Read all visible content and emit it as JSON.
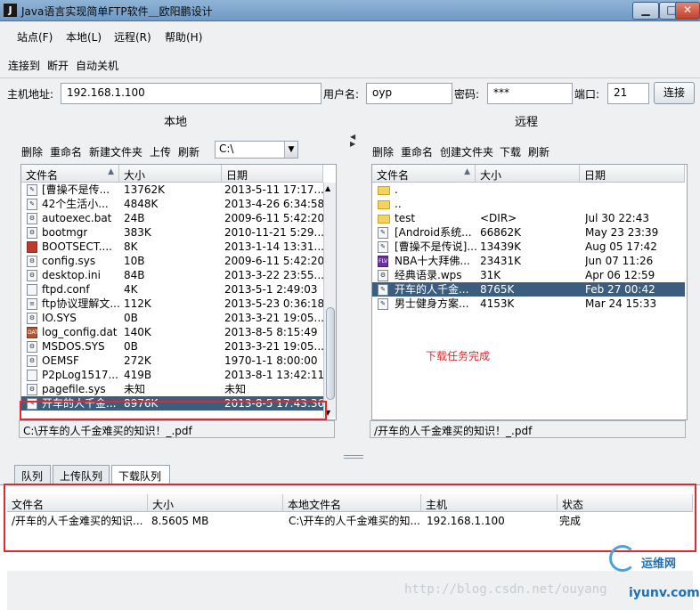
{
  "window": {
    "title": "Java语言实现简单FTP软件＿欧阳鹏设计",
    "app_icon": "java-app-icon",
    "controls": [
      "minimize",
      "maximize",
      "close"
    ]
  },
  "menu": [
    {
      "label": "站点(F)"
    },
    {
      "label": "本地(L)"
    },
    {
      "label": "远程(R)"
    },
    {
      "label": "帮助(H)"
    }
  ],
  "toolbar": {
    "items": [
      "连接到",
      "断开",
      "自动关机"
    ]
  },
  "connection": {
    "host_label": "主机地址:",
    "host_value": "192.168.1.100",
    "user_label": "用户名:",
    "user_value": "oyp",
    "pass_label": "密码:",
    "pass_value": "***",
    "port_label": "端口:",
    "port_value": "21",
    "connect_button": "连接"
  },
  "local": {
    "title": "本地",
    "actions": [
      "删除",
      "重命名",
      "新建文件夹",
      "上传",
      "刷新"
    ],
    "drive": "C:\\",
    "columns": [
      "文件名",
      "大小",
      "日期"
    ],
    "sort_indicator": "▲",
    "rows": [
      {
        "name": "[曹操不是传...",
        "size": "13762K",
        "date": "2013-5-11 17:17...",
        "icon": "text-file"
      },
      {
        "name": "42个生活小...",
        "size": "4848K",
        "date": "2013-4-26 6:34:58",
        "icon": "text-file"
      },
      {
        "name": "autoexec.bat",
        "size": "24B",
        "date": "2009-6-11 5:42:20",
        "icon": "gear-file"
      },
      {
        "name": "bootmgr",
        "size": "383K",
        "date": "2010-11-21 5:29...",
        "icon": "gear-file"
      },
      {
        "name": "BOOTSECT....",
        "size": "8K",
        "date": "2013-1-14 13:31...",
        "icon": "red-file"
      },
      {
        "name": "config.sys",
        "size": "10B",
        "date": "2009-6-11 5:42:20",
        "icon": "gear-file"
      },
      {
        "name": "desktop.ini",
        "size": "84B",
        "date": "2013-3-22 23:55...",
        "icon": "gear-file"
      },
      {
        "name": "ftpd.conf",
        "size": "4K",
        "date": "2013-5-1 2:49:03",
        "icon": "blank-file"
      },
      {
        "name": "ftp协议理解文...",
        "size": "112K",
        "date": "2013-5-23 0:36:18",
        "icon": "doc-file"
      },
      {
        "name": "IO.SYS",
        "size": "0B",
        "date": "2013-3-21 19:05...",
        "icon": "gear-file"
      },
      {
        "name": "log_config.dat",
        "size": "140K",
        "date": "2013-8-5 8:15:49",
        "icon": "dat-file"
      },
      {
        "name": "MSDOS.SYS",
        "size": "0B",
        "date": "2013-3-21 19:05...",
        "icon": "gear-file"
      },
      {
        "name": "OEMSF",
        "size": "272K",
        "date": "1970-1-1 8:00:00",
        "icon": "gear-file"
      },
      {
        "name": "P2pLog1517...",
        "size": "419B",
        "date": "2013-8-1 13:42:11",
        "icon": "blank-file"
      },
      {
        "name": "pagefile.sys",
        "size": "未知",
        "date": "未知",
        "icon": "gear-file"
      },
      {
        "name": "开车的人千金...",
        "size": "8976K",
        "date": "2013-8-5 17:43:36",
        "icon": "text-file",
        "selected": true
      }
    ],
    "path": "C:\\开车的人千金难买的知识！_.pdf"
  },
  "remote": {
    "title": "远程",
    "actions": [
      "删除",
      "重命名",
      "创建文件夹",
      "下载",
      "刷新"
    ],
    "columns": [
      "文件名",
      "大小",
      "日期"
    ],
    "sort_indicator": "▲",
    "rows": [
      {
        "name": ".",
        "size": "",
        "date": "",
        "icon": "folder"
      },
      {
        "name": "..",
        "size": "",
        "date": "",
        "icon": "folder"
      },
      {
        "name": "test",
        "size": "<DIR>",
        "date": "Jul 30 22:43",
        "icon": "folder"
      },
      {
        "name": "[Android系统...",
        "size": "66862K",
        "date": "May 23 23:39",
        "icon": "text-file"
      },
      {
        "name": "[曹操不是传说]...",
        "size": "13439K",
        "date": "Aug 05 17:42",
        "icon": "text-file"
      },
      {
        "name": "NBA十大拜佛...",
        "size": "23431K",
        "date": "Jun 07 11:26",
        "icon": "flv-file"
      },
      {
        "name": "经典语录.wps",
        "size": "31K",
        "date": "Apr 06 12:59",
        "icon": "gear-file"
      },
      {
        "name": "开车的人千金...",
        "size": "8765K",
        "date": "Feb 27 00:42",
        "icon": "text-file",
        "selected": true
      },
      {
        "name": "男士健身方案...",
        "size": "4153K",
        "date": "Mar 24 15:33",
        "icon": "text-file"
      }
    ],
    "status_message": "下载任务完成",
    "path": "/开车的人千金难买的知识！_.pdf"
  },
  "queue": {
    "tabs": [
      "队列",
      "上传队列",
      "下载队列"
    ],
    "active_tab": 2,
    "columns": [
      "文件名",
      "大小",
      "本地文件名",
      "主机",
      "状态"
    ],
    "rows": [
      {
        "file": "/开车的人千金难买的知识...",
        "size": "8.5605 MB",
        "local": "C:\\开车的人千金难买的知...",
        "host": "192.168.1.100",
        "status": "完成"
      }
    ]
  },
  "watermark": {
    "url": "http://blog.csdn.net/ouyang",
    "brand_cn": "运维网",
    "brand_en": "iyunv.com"
  },
  "colors": {
    "selection": "#3b5e7e",
    "highlight_box": "#e1282c",
    "status_text": "#e1282c",
    "brand": "#1d6fb8"
  }
}
